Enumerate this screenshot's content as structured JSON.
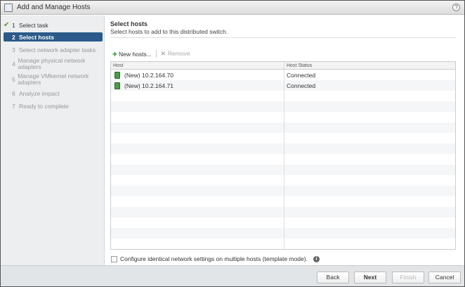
{
  "window": {
    "title": "Add and Manage Hosts",
    "help": "?"
  },
  "steps": [
    {
      "num": "1",
      "label": "Select task",
      "state": "done"
    },
    {
      "num": "2",
      "label": "Select hosts",
      "state": "active"
    },
    {
      "num": "3",
      "label": "Select network adapter tasks",
      "state": "pending"
    },
    {
      "num": "4",
      "label": "Manage physical network adapters",
      "state": "pending"
    },
    {
      "num": "5",
      "label": "Manage VMkernel network adapters",
      "state": "pending"
    },
    {
      "num": "6",
      "label": "Analyze impact",
      "state": "pending"
    },
    {
      "num": "7",
      "label": "Ready to complete",
      "state": "pending"
    }
  ],
  "main": {
    "title": "Select hosts",
    "subtitle": "Select hosts to add to this distributed switch.",
    "toolbar": {
      "new_hosts": "New hosts...",
      "remove": "Remove"
    },
    "table": {
      "columns": [
        "Host",
        "Host Status"
      ],
      "rows": [
        {
          "host": "(New) 10.2.164.70",
          "status": "Connected"
        },
        {
          "host": "(New) 10.2.164.71",
          "status": "Connected"
        }
      ]
    },
    "template_mode": {
      "label": "Configure identical network settings on multiple hosts (template mode).",
      "checked": false,
      "info": "i"
    }
  },
  "footer": {
    "back": "Back",
    "next": "Next",
    "finish": "Finish",
    "cancel": "Cancel"
  }
}
